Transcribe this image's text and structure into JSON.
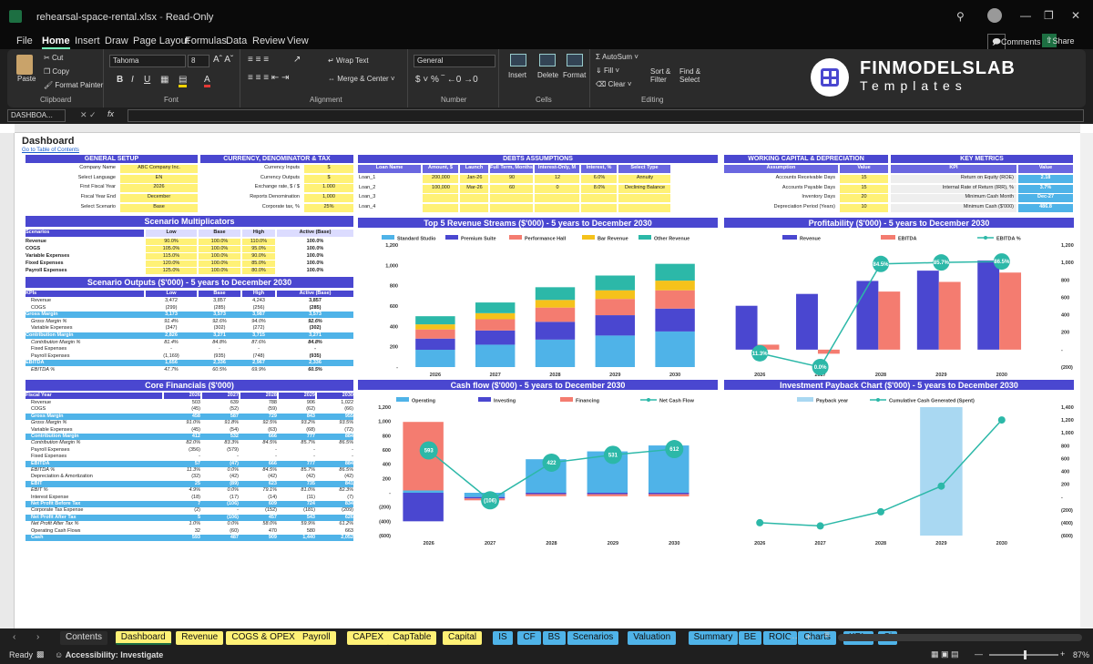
{
  "window": {
    "filename": "rehearsal-space-rental.xlsx",
    "mode": "Read-Only"
  },
  "menu": [
    "File",
    "Home",
    "Insert",
    "Draw",
    "Page Layout",
    "Formulas",
    "Data",
    "Review",
    "View"
  ],
  "menu_active": "Home",
  "header_buttons": {
    "comments": "Comments",
    "share": "Share"
  },
  "ribbon": {
    "clipboard": {
      "paste": "Paste",
      "cut": "Cut",
      "copy": "Copy",
      "format_painter": "Format Painter",
      "label": "Clipboard"
    },
    "font": {
      "name": "Tahoma",
      "size": "8",
      "label": "Font"
    },
    "alignment": {
      "wrap": "Wrap Text",
      "merge": "Merge & Center",
      "label": "Alignment"
    },
    "number": {
      "format": "General",
      "label": "Number"
    },
    "cells": {
      "insert": "Insert",
      "delete": "Delete",
      "format": "Format",
      "label": "Cells"
    },
    "editing": {
      "autosum": "AutoSum",
      "fill": "Fill",
      "clear": "Clear",
      "sort": "Sort & Filter",
      "find": "Find & Select",
      "label": "Editing"
    }
  },
  "logo": {
    "line1": "FINMODELSLAB",
    "line2": "Templates"
  },
  "formula_bar": {
    "name_box": "DASHBOA...",
    "fx": "fx"
  },
  "sheet": {
    "title": "Dashboard",
    "toc_link": "Go to Table of Contents",
    "general_setup": {
      "header": "GENERAL SETUP",
      "rows": [
        [
          "Company Name",
          "ABC Company Inc."
        ],
        [
          "Select Language",
          "EN"
        ],
        [
          "First Fiscal Year",
          "2026"
        ],
        [
          "Fiscal Year End",
          "December"
        ],
        [
          "Select Scenario",
          "Base"
        ]
      ]
    },
    "currency": {
      "header": "CURRENCY, DENOMINATOR & TAX",
      "rows": [
        [
          "Currency Inputs",
          "$"
        ],
        [
          "Currency Outputs",
          "$"
        ],
        [
          "Exchange rate, $ / $",
          "1.000"
        ],
        [
          "Reports Denomination",
          "1,000"
        ],
        [
          "Corporate tax, %",
          "25%"
        ]
      ]
    },
    "debts": {
      "header": "DEBTS ASSUMPTIONS",
      "cols": [
        "Loan Name",
        "Amount, $",
        "Launch",
        "Full Term, Months",
        "Interest-Only, M",
        "Interest, %",
        "Select Type"
      ],
      "rows": [
        [
          "Loan_1",
          "200,000",
          "Jan-26",
          "90",
          "12",
          "6.0%",
          "Annuity"
        ],
        [
          "Loan_2",
          "100,000",
          "Mar-26",
          "60",
          "0",
          "8.0%",
          "Declining Balance"
        ],
        [
          "Loan_3",
          "",
          "",
          "",
          "",
          "",
          ""
        ],
        [
          "Loan_4",
          "",
          "",
          "",
          "",
          "",
          ""
        ]
      ]
    },
    "working_capital": {
      "header": "WORKING CAPITAL & DEPRECIATION",
      "cols": [
        "Assumption",
        "Value"
      ],
      "rows": [
        [
          "Accounts Receivable Days",
          "15"
        ],
        [
          "Accounts Payable Days",
          "15"
        ],
        [
          "Inventory Days",
          "20"
        ],
        [
          "Depreciation Period (Years)",
          "10"
        ]
      ]
    },
    "key_metrics": {
      "header": "KEY METRICS",
      "cols": [
        "KPI",
        "Value"
      ],
      "rows": [
        [
          "Return on Equity (ROE)",
          "2.18"
        ],
        [
          "Internal Rate of Return (IRR), %",
          "3.7%"
        ],
        [
          "Minimum Cash Month",
          "Dec-27"
        ],
        [
          "Minimum Cash ($'000)",
          "486.8"
        ]
      ]
    },
    "scenario_mult": {
      "header": "Scenario Multiplicators",
      "cols": [
        "Scenarios",
        "Low",
        "Base",
        "High",
        "Active (Base)"
      ],
      "rows": [
        [
          "Revenue",
          "90.0%",
          "100.0%",
          "110.0%",
          "100.0%"
        ],
        [
          "COGS",
          "105.0%",
          "100.0%",
          "95.0%",
          "100.0%"
        ],
        [
          "Variable Expenses",
          "115.0%",
          "100.0%",
          "90.0%",
          "100.0%"
        ],
        [
          "Fixed Expenses",
          "120.0%",
          "100.0%",
          "85.0%",
          "100.0%"
        ],
        [
          "Payroll Expenses",
          "125.0%",
          "100.0%",
          "80.0%",
          "100.0%"
        ]
      ]
    },
    "scenario_out": {
      "header": "Scenario Outputs ($'000) - 5 years to December 2030",
      "cols": [
        "KPIs",
        "Low",
        "Base",
        "High",
        "Active (Base)"
      ],
      "rows": [
        [
          "Revenue",
          "3,472",
          "3,857",
          "4,243",
          "3,857"
        ],
        [
          "COGS",
          "(299)",
          "(285)",
          "(256)",
          "(285)"
        ],
        [
          "Gross Margin",
          "3,173",
          "3,573",
          "3,987",
          "3,573"
        ],
        [
          "Gross Margin %",
          "91.4%",
          "92.6%",
          "94.0%",
          "92.6%"
        ],
        [
          "Variable Expenses",
          "(347)",
          "(302)",
          "(272)",
          "(302)"
        ],
        [
          "Contribution Margin",
          "2,826",
          "3,271",
          "3,715",
          "3,271"
        ],
        [
          "Contribution Margin %",
          "81.4%",
          "84.8%",
          "87.6%",
          "84.8%"
        ],
        [
          "Fixed Expenses",
          "-",
          "-",
          "-",
          "-"
        ],
        [
          "Payroll Expenses",
          "(1,169)",
          "(935)",
          "(748)",
          "(935)"
        ],
        [
          "EBITDA",
          "1,656",
          "2,336",
          "2,967",
          "2,336"
        ],
        [
          "EBITDA %",
          "47.7%",
          "60.5%",
          "69.9%",
          "60.5%"
        ]
      ]
    },
    "core_fin": {
      "header": "Core Financials ($'000)",
      "cols": [
        "Fiscal Year",
        "2026",
        "2027",
        "2028",
        "2029",
        "2030"
      ],
      "rows": [
        [
          "Revenue",
          "503",
          "639",
          "788",
          "906",
          "1,022"
        ],
        [
          "COGS",
          "(45)",
          "(52)",
          "(59)",
          "(62)",
          "(66)"
        ],
        [
          "Gross Margin",
          "458",
          "587",
          "729",
          "843",
          "955"
        ],
        [
          "Gross Margin %",
          "91.0%",
          "91.8%",
          "92.5%",
          "93.2%",
          "93.5%"
        ],
        [
          "Variable Expenses",
          "(45)",
          "(54)",
          "(63)",
          "(68)",
          "(72)"
        ],
        [
          "Contribution Margin",
          "412",
          "532",
          "666",
          "777",
          "884"
        ],
        [
          "Contribution Margin %",
          "82.0%",
          "83.3%",
          "84.5%",
          "85.7%",
          "86.5%"
        ],
        [
          "Payroll Expenses",
          "(356)",
          "(579)",
          "-",
          "-",
          "-"
        ],
        [
          "Fixed Expenses",
          "-",
          "-",
          "-",
          "-",
          "-"
        ],
        [
          "EBITDA",
          "57",
          "(47)",
          "666",
          "777",
          "884"
        ],
        [
          "EBITDA %",
          "11.3%",
          "0.0%",
          "84.5%",
          "85.7%",
          "86.5%"
        ],
        [
          "Depreciation & Amortization",
          "(32)",
          "(42)",
          "(42)",
          "(42)",
          "(42)"
        ],
        [
          "EBIT",
          "25",
          "(89)",
          "623",
          "735",
          "841"
        ],
        [
          "EBIT %",
          "4.9%",
          "0.0%",
          "79.1%",
          "81.0%",
          "82.3%"
        ],
        [
          "Interest Expense",
          "(18)",
          "(17)",
          "(14)",
          "(11)",
          "(7)"
        ],
        [
          "Net Profit Before Tax",
          "7",
          "(106)",
          "609",
          "724",
          "834"
        ],
        [
          "Corporate Tax Expense",
          "(2)",
          "-",
          "(152)",
          "(181)",
          "(209)"
        ],
        [
          "Net Profit After Tax",
          "5",
          "(106)",
          "457",
          "543",
          "626"
        ],
        [
          "Net Profit After Tax %",
          "1.0%",
          "0.0%",
          "58.0%",
          "59.9%",
          "61.2%"
        ],
        [
          "Operating Cash Flows",
          "32",
          "(60)",
          "470",
          "580",
          "663"
        ],
        [
          "Cash",
          "593",
          "487",
          "909",
          "1,440",
          "2,052"
        ]
      ]
    }
  },
  "chart_data": [
    {
      "type": "bar",
      "stacked": true,
      "title": "Top 5 Revenue Streams ($'000) - 5 years to December 2030",
      "categories": [
        "2026",
        "2027",
        "2028",
        "2029",
        "2030"
      ],
      "series": [
        {
          "name": "Standard Studio",
          "values": [
            170,
            220,
            270,
            310,
            350
          ]
        },
        {
          "name": "Premium Suite",
          "values": [
            110,
            140,
            175,
            200,
            225
          ]
        },
        {
          "name": "Performance Hall",
          "values": [
            90,
            110,
            140,
            160,
            180
          ]
        },
        {
          "name": "Bar Revenue",
          "values": [
            50,
            60,
            75,
            85,
            95
          ]
        },
        {
          "name": "Other Revenue",
          "values": [
            80,
            105,
            125,
            145,
            165
          ]
        }
      ],
      "ylim": [
        0,
        1200
      ],
      "yticks": [
        "-",
        "200",
        "400",
        "600",
        "800",
        "1,000",
        "1,200"
      ],
      "colors": [
        "#4fb3e8",
        "#4a47d0",
        "#f47c70",
        "#f5c21b",
        "#2cb8a8"
      ]
    },
    {
      "type": "bar+line",
      "title": "Profitability ($'000) - 5 years to December 2030",
      "categories": [
        "2026",
        "2027",
        "2028",
        "2029",
        "2030"
      ],
      "series": [
        {
          "name": "Revenue",
          "values": [
            503,
            639,
            788,
            906,
            1022
          ]
        },
        {
          "name": "EBITDA",
          "values": [
            57,
            -47,
            666,
            777,
            884
          ]
        },
        {
          "name": "EBITDA %",
          "values": [
            11.3,
            0.0,
            84.5,
            85.7,
            86.5
          ],
          "labels": [
            "11.3%",
            "0.0%",
            "84.5%",
            "85.7%",
            "86.5%"
          ]
        }
      ],
      "ylim": [
        -200,
        1200
      ],
      "yticks": [
        "(200)",
        "-",
        "200",
        "400",
        "600",
        "800",
        "1,000",
        "1,200"
      ],
      "y2ticks": [
        "0%",
        "10%",
        "20%",
        "30%",
        "40%",
        "50%",
        "60%",
        "70%",
        "80%",
        "90%",
        "100%"
      ],
      "colors": [
        "#4a47d0",
        "#f47c70",
        "#2cb8a8"
      ]
    },
    {
      "type": "bar+line",
      "stacked": true,
      "title": "Cash flow ($'000) - 5 years to December 2030",
      "categories": [
        "2026",
        "2027",
        "2028",
        "2029",
        "2030"
      ],
      "series": [
        {
          "name": "Operating",
          "values": [
            32,
            -60,
            470,
            580,
            663
          ]
        },
        {
          "name": "Investing",
          "values": [
            -400,
            -20,
            -20,
            -20,
            -20
          ]
        },
        {
          "name": "Financing",
          "values": [
            961,
            -26,
            -28,
            -29,
            -31
          ]
        },
        {
          "name": "Net Cash Flow",
          "values": [
            593,
            -106,
            422,
            531,
            612
          ]
        }
      ],
      "ylim": [
        -600,
        1200
      ],
      "yticks": [
        "(600)",
        "(400)",
        "(200)",
        "-",
        "200",
        "400",
        "600",
        "800",
        "1,000",
        "1,200"
      ],
      "colors": [
        "#4fb3e8",
        "#4a47d0",
        "#f47c70",
        "#2cb8a8"
      ]
    },
    {
      "type": "bar+line",
      "title": "Investment Payback Chart ($'000) - 5 years to December 2030",
      "categories": [
        "2026",
        "2027",
        "2028",
        "2029",
        "2030"
      ],
      "series": [
        {
          "name": "Payback year",
          "values": [
            0,
            0,
            0,
            1,
            0
          ]
        },
        {
          "name": "Cumulative Cash Generated (Spent)",
          "values": [
            -400,
            -450,
            -230,
            170,
            1200
          ]
        }
      ],
      "ylim": [
        -600,
        1400
      ],
      "yticks": [
        "(600)",
        "(400)",
        "(200)",
        "-",
        "200",
        "400",
        "600",
        "800",
        "1,000",
        "1,200",
        "1,400"
      ],
      "colors": [
        "#a9d8f2",
        "#2cb8a8"
      ]
    }
  ],
  "tabs": [
    "Contents",
    "Dashboard",
    "Revenue",
    "COGS & OPEX",
    "Payroll",
    "CAPEX",
    "CapTable",
    "Capital",
    "IS",
    "CF",
    "BS",
    "Scenarios",
    "Valuation",
    "Summary",
    "BE",
    "ROIC",
    "Charts",
    "KPIs",
    "Si"
  ],
  "tab_colors": [
    "#2b2b2b",
    "#fff176",
    "#fff176",
    "#fff176",
    "#fff176",
    "#fff176",
    "#fff176",
    "#fff176",
    "#4fb3e8",
    "#4fb3e8",
    "#4fb3e8",
    "#4fb3e8",
    "#4fb3e8",
    "#4fb3e8",
    "#4fb3e8",
    "#4fb3e8",
    "#4fb3e8",
    "#4fb3e8",
    "#4fb3e8"
  ],
  "active_tab": "Dashboard",
  "status": {
    "ready": "Ready",
    "accessibility": "Accessibility: Investigate",
    "zoom": "87%"
  }
}
